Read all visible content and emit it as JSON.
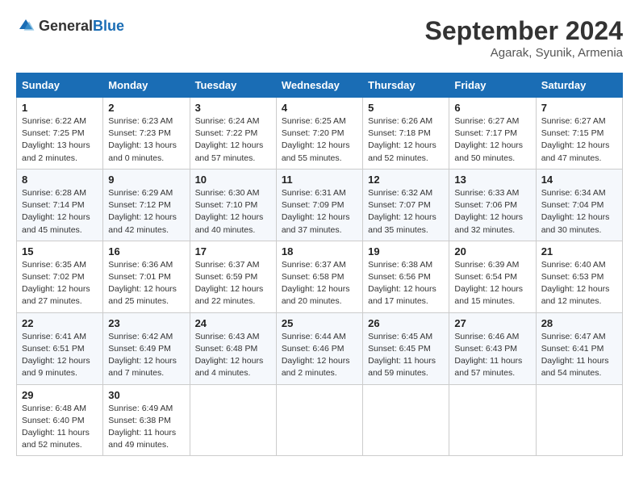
{
  "header": {
    "logo_general": "General",
    "logo_blue": "Blue",
    "title": "September 2024",
    "location": "Agarak, Syunik, Armenia"
  },
  "days_of_week": [
    "Sunday",
    "Monday",
    "Tuesday",
    "Wednesday",
    "Thursday",
    "Friday",
    "Saturday"
  ],
  "weeks": [
    [
      {
        "day": 1,
        "info": "Sunrise: 6:22 AM\nSunset: 7:25 PM\nDaylight: 13 hours\nand 2 minutes."
      },
      {
        "day": 2,
        "info": "Sunrise: 6:23 AM\nSunset: 7:23 PM\nDaylight: 13 hours\nand 0 minutes."
      },
      {
        "day": 3,
        "info": "Sunrise: 6:24 AM\nSunset: 7:22 PM\nDaylight: 12 hours\nand 57 minutes."
      },
      {
        "day": 4,
        "info": "Sunrise: 6:25 AM\nSunset: 7:20 PM\nDaylight: 12 hours\nand 55 minutes."
      },
      {
        "day": 5,
        "info": "Sunrise: 6:26 AM\nSunset: 7:18 PM\nDaylight: 12 hours\nand 52 minutes."
      },
      {
        "day": 6,
        "info": "Sunrise: 6:27 AM\nSunset: 7:17 PM\nDaylight: 12 hours\nand 50 minutes."
      },
      {
        "day": 7,
        "info": "Sunrise: 6:27 AM\nSunset: 7:15 PM\nDaylight: 12 hours\nand 47 minutes."
      }
    ],
    [
      {
        "day": 8,
        "info": "Sunrise: 6:28 AM\nSunset: 7:14 PM\nDaylight: 12 hours\nand 45 minutes."
      },
      {
        "day": 9,
        "info": "Sunrise: 6:29 AM\nSunset: 7:12 PM\nDaylight: 12 hours\nand 42 minutes."
      },
      {
        "day": 10,
        "info": "Sunrise: 6:30 AM\nSunset: 7:10 PM\nDaylight: 12 hours\nand 40 minutes."
      },
      {
        "day": 11,
        "info": "Sunrise: 6:31 AM\nSunset: 7:09 PM\nDaylight: 12 hours\nand 37 minutes."
      },
      {
        "day": 12,
        "info": "Sunrise: 6:32 AM\nSunset: 7:07 PM\nDaylight: 12 hours\nand 35 minutes."
      },
      {
        "day": 13,
        "info": "Sunrise: 6:33 AM\nSunset: 7:06 PM\nDaylight: 12 hours\nand 32 minutes."
      },
      {
        "day": 14,
        "info": "Sunrise: 6:34 AM\nSunset: 7:04 PM\nDaylight: 12 hours\nand 30 minutes."
      }
    ],
    [
      {
        "day": 15,
        "info": "Sunrise: 6:35 AM\nSunset: 7:02 PM\nDaylight: 12 hours\nand 27 minutes."
      },
      {
        "day": 16,
        "info": "Sunrise: 6:36 AM\nSunset: 7:01 PM\nDaylight: 12 hours\nand 25 minutes."
      },
      {
        "day": 17,
        "info": "Sunrise: 6:37 AM\nSunset: 6:59 PM\nDaylight: 12 hours\nand 22 minutes."
      },
      {
        "day": 18,
        "info": "Sunrise: 6:37 AM\nSunset: 6:58 PM\nDaylight: 12 hours\nand 20 minutes."
      },
      {
        "day": 19,
        "info": "Sunrise: 6:38 AM\nSunset: 6:56 PM\nDaylight: 12 hours\nand 17 minutes."
      },
      {
        "day": 20,
        "info": "Sunrise: 6:39 AM\nSunset: 6:54 PM\nDaylight: 12 hours\nand 15 minutes."
      },
      {
        "day": 21,
        "info": "Sunrise: 6:40 AM\nSunset: 6:53 PM\nDaylight: 12 hours\nand 12 minutes."
      }
    ],
    [
      {
        "day": 22,
        "info": "Sunrise: 6:41 AM\nSunset: 6:51 PM\nDaylight: 12 hours\nand 9 minutes."
      },
      {
        "day": 23,
        "info": "Sunrise: 6:42 AM\nSunset: 6:49 PM\nDaylight: 12 hours\nand 7 minutes."
      },
      {
        "day": 24,
        "info": "Sunrise: 6:43 AM\nSunset: 6:48 PM\nDaylight: 12 hours\nand 4 minutes."
      },
      {
        "day": 25,
        "info": "Sunrise: 6:44 AM\nSunset: 6:46 PM\nDaylight: 12 hours\nand 2 minutes."
      },
      {
        "day": 26,
        "info": "Sunrise: 6:45 AM\nSunset: 6:45 PM\nDaylight: 11 hours\nand 59 minutes."
      },
      {
        "day": 27,
        "info": "Sunrise: 6:46 AM\nSunset: 6:43 PM\nDaylight: 11 hours\nand 57 minutes."
      },
      {
        "day": 28,
        "info": "Sunrise: 6:47 AM\nSunset: 6:41 PM\nDaylight: 11 hours\nand 54 minutes."
      }
    ],
    [
      {
        "day": 29,
        "info": "Sunrise: 6:48 AM\nSunset: 6:40 PM\nDaylight: 11 hours\nand 52 minutes."
      },
      {
        "day": 30,
        "info": "Sunrise: 6:49 AM\nSunset: 6:38 PM\nDaylight: 11 hours\nand 49 minutes."
      },
      null,
      null,
      null,
      null,
      null
    ]
  ]
}
